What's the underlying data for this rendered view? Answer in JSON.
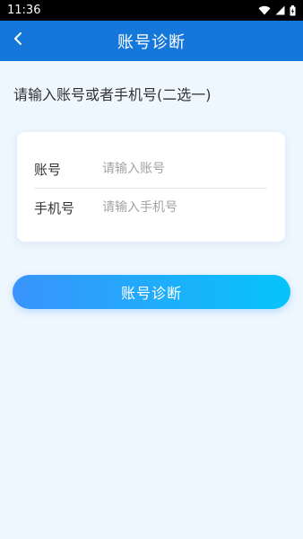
{
  "status_bar": {
    "time": "11:36",
    "icons": [
      "wifi-icon",
      "signal-icon",
      "battery-icon"
    ]
  },
  "header": {
    "title": "账号诊断",
    "back_icon": "chevron-left-icon"
  },
  "instruction": "请输入账号或者手机号(二选一)",
  "form": {
    "account": {
      "label": "账号",
      "placeholder": "请输入账号",
      "value": ""
    },
    "phone": {
      "label": "手机号",
      "placeholder": "请输入手机号",
      "value": ""
    }
  },
  "submit_label": "账号诊断",
  "colors": {
    "header": "#1577d9",
    "background": "#eef6fe",
    "button_start": "#3a93fb",
    "button_end": "#06c4fb"
  }
}
